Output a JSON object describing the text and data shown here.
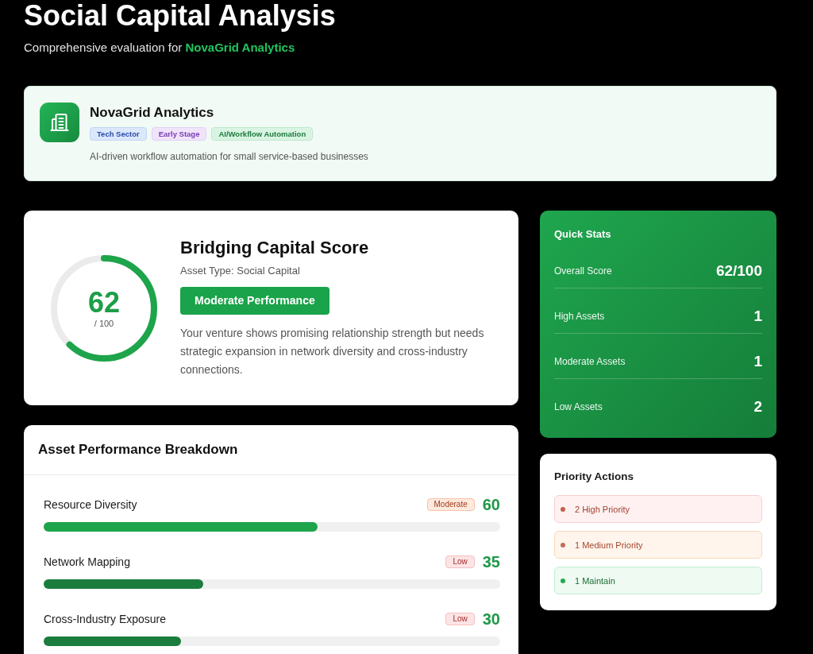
{
  "header": {
    "title": "Social Capital Analysis",
    "subtitle": "Comprehensive evaluation for **NovaGrid Analytics**"
  },
  "company": {
    "name": "NovaGrid Analytics",
    "tags": [
      {
        "label": "Tech Sector",
        "kind": "sector"
      },
      {
        "label": "Early Stage",
        "kind": "stage"
      },
      {
        "label": "AI/Workflow Automation",
        "kind": "industry"
      }
    ],
    "description": "AI-driven workflow automation for small service-based businesses"
  },
  "score": {
    "value": "62",
    "max": "/ 100",
    "level": 0.62,
    "title": "Bridging Capital Score",
    "asset_type": "Asset Type: Social Capital",
    "rating": "Moderate Performance",
    "description": "Your venture shows promising relationship strength but needs strategic expansion in network diversity and cross-industry connections."
  },
  "breakdown": {
    "title": "Asset Performance Breakdown",
    "assets": [
      {
        "name": "Resource Diversity",
        "rating": "Moderate",
        "kind": "moderate",
        "score": "60",
        "level": 0.6
      },
      {
        "name": "Network Mapping",
        "rating": "Low",
        "kind": "low",
        "score": "35",
        "level": 0.35
      },
      {
        "name": "Cross-Industry Exposure",
        "rating": "Low",
        "kind": "low",
        "score": "30",
        "level": 0.3
      }
    ]
  },
  "quick_stats": {
    "title": "Quick Stats",
    "rows": [
      {
        "label": "Overall Score",
        "value": "62/100"
      },
      {
        "label": "High Assets",
        "value": "1"
      },
      {
        "label": "Moderate Assets",
        "value": "1"
      },
      {
        "label": "Low Assets",
        "value": "2"
      }
    ]
  },
  "priority_actions": {
    "title": "Priority Actions",
    "items": [
      {
        "label": "2 High Priority",
        "kind": "high",
        "color": "#c0624e"
      },
      {
        "label": "1 Medium Priority",
        "kind": "medium",
        "color": "#c4705a"
      },
      {
        "label": "1 Maintain",
        "kind": "maintain",
        "color": "#22a94f"
      }
    ]
  }
}
